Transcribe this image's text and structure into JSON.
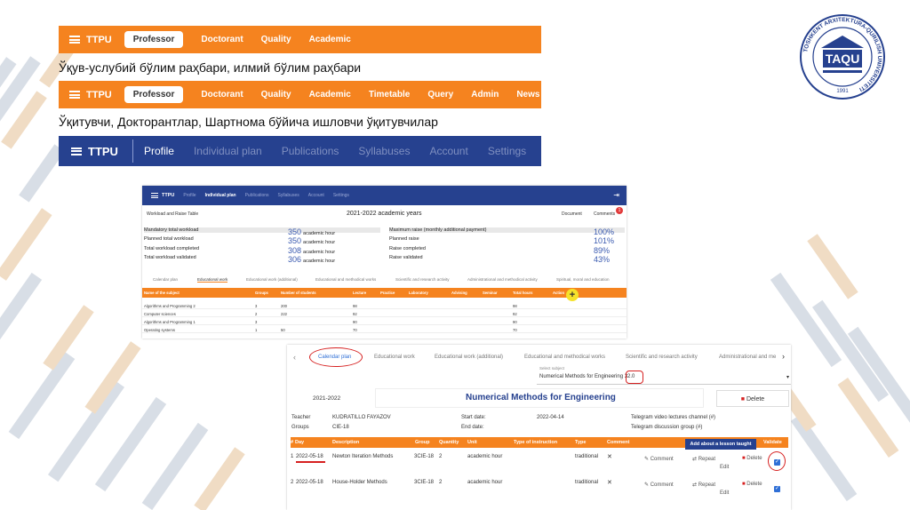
{
  "bar1": {
    "brand": "TTPU",
    "items": [
      "Professor",
      "Doctorant",
      "Quality",
      "Academic"
    ],
    "active": "Professor"
  },
  "caption1": "Ўқув-услубий бўлим раҳбари, илмий бўлим раҳбари",
  "bar2": {
    "brand": "TTPU",
    "items": [
      "Professor",
      "Doctorant",
      "Quality",
      "Academic",
      "Timetable",
      "Query",
      "Admin",
      "News"
    ],
    "active": "Professor"
  },
  "caption2": "Ўқитувчи, Докторантлар, Шартнома бўйича ишловчи ўқитувчилар",
  "bar3": {
    "brand": "TTPU",
    "items": [
      "Profile",
      "Individual plan",
      "Publications",
      "Syllabuses",
      "Account",
      "Settings"
    ],
    "current": "Profile"
  },
  "logo": {
    "text": "TAQU",
    "ring": "TOSHKENT ARXITEKTURA-QURILISH UNIVERSITETI",
    "year": "1991"
  },
  "shot1": {
    "nav": {
      "brand": "TTPU",
      "items": [
        "Profile",
        "Individual plan",
        "Publications",
        "Syllabuses",
        "Account",
        "Settings"
      ],
      "current": "Individual plan"
    },
    "subtitle": "Workload and Raise Table",
    "year_title": "2021-2022 academic years",
    "document_btn": "Document",
    "comments_btn": "Comments",
    "comments_badge": "1",
    "left_stats": [
      {
        "label": "Mandatory total workload",
        "value": "350",
        "unit": "academic hour"
      },
      {
        "label": "Planned total workload",
        "value": "350",
        "unit": "academic hour"
      },
      {
        "label": "Total workload completed",
        "value": "308",
        "unit": "academic hour"
      },
      {
        "label": "Total workload validated",
        "value": "306",
        "unit": "academic hour"
      }
    ],
    "right_stats": [
      {
        "label": "Maximum raise (monthly additional payment)",
        "value": "100%"
      },
      {
        "label": "Planned raise",
        "value": "101%"
      },
      {
        "label": "Raise completed",
        "value": "89%"
      },
      {
        "label": "Raise validated",
        "value": "43%"
      }
    ],
    "tabs": [
      "Calendar plan",
      "Educational work",
      "Educational work (additional)",
      "Educational and methodical works",
      "Scientific and research activity",
      "Administrational and methodical activity",
      "Spiritual, moral and education"
    ],
    "columns": [
      "Name of the subject",
      "Groups",
      "Number of students",
      "Lecture",
      "Practice",
      "Laboratory",
      "Advising",
      "Seminar",
      "Total hours",
      "Action"
    ],
    "rows": [
      [
        "Algorithms and Programming 2",
        "3",
        "200",
        "98",
        "",
        "",
        "",
        "",
        "98"
      ],
      [
        "Computer sciences",
        "2",
        "222",
        "92",
        "",
        "",
        "",
        "",
        "92"
      ],
      [
        "Algorithms and Programming 1",
        "3",
        "",
        "90",
        "",
        "",
        "",
        "",
        "90"
      ],
      [
        "Operating systems",
        "1",
        "50",
        "70",
        "",
        "",
        "",
        "",
        "70"
      ]
    ]
  },
  "shot2": {
    "tabs": [
      "Calendar plan",
      "Educational work",
      "Educational work (additional)",
      "Educational and methodical works",
      "Scientific and research activity",
      "Administrational and me"
    ],
    "select_label": "Select subject",
    "select_value": "Numerical Methods for Engineering",
    "select_hours": "32.0",
    "year": "2021-2022",
    "course_title": "Numerical Methods for Engineering",
    "delete_btn": "Delete",
    "teacher_label": "Teacher",
    "teacher": "KUDRATILLO FAYAZOV",
    "groups_label": "Groups",
    "groups": "CIE-18",
    "start_label": "Start date:",
    "start": "2022-04-14",
    "end_label": "End date:",
    "telegram1": "Telegram video lectures channel (#)",
    "telegram2": "Telegram discussion group (#)",
    "columns": [
      "#",
      "Day",
      "Description",
      "Group",
      "Quantity",
      "Unit",
      "Type of instruction",
      "Type",
      "Comment",
      "",
      "Validate"
    ],
    "add_btn": "Add about a lesson taught",
    "rows": [
      {
        "n": "1",
        "day": "2022-05-18",
        "desc": "Newton Iteration Methods",
        "group": "3CIE-18",
        "qty": "2",
        "unit": "academic hour",
        "type": "traditional",
        "comment": "✕"
      },
      {
        "n": "2",
        "day": "2022-05-18",
        "desc": "House-Holder Methods",
        "group": "3CIE-18",
        "qty": "2",
        "unit": "academic hour",
        "type": "traditional",
        "comment": "✕"
      }
    ],
    "actions": {
      "comment": "Comment",
      "repeat": "Repeat",
      "edit": "Edit",
      "delete": "Delete"
    }
  }
}
